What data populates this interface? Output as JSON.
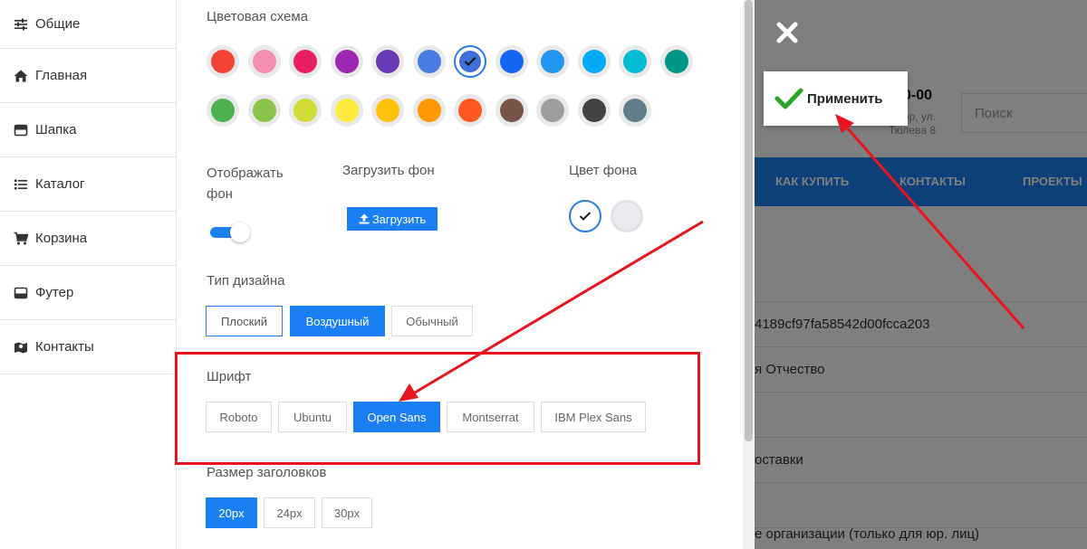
{
  "sidebar": {
    "items": [
      {
        "label": "Общие",
        "icon": "sliders-icon"
      },
      {
        "label": "Главная",
        "icon": "home-icon"
      },
      {
        "label": "Шапка",
        "icon": "header-icon"
      },
      {
        "label": "Каталог",
        "icon": "list-icon"
      },
      {
        "label": "Корзина",
        "icon": "cart-icon"
      },
      {
        "label": "Футер",
        "icon": "footer-icon"
      },
      {
        "label": "Контакты",
        "icon": "map-icon"
      }
    ]
  },
  "panel": {
    "color_scheme_label": "Цветовая схема",
    "colors_row1": [
      "#f44336",
      "#f48fb1",
      "#e91e63",
      "#9c27b0",
      "#673ab7",
      "#4a7be4",
      "#3f6fd8",
      "#1565f5",
      "#2196f3",
      "#03a9f4",
      "#00bcd4",
      "#009688"
    ],
    "colors_row2": [
      "#4caf50",
      "#8bc34a",
      "#cddc39",
      "#ffeb3b",
      "#ffc107",
      "#ff9800",
      "#ff5722",
      "#795548",
      "#9e9e9e",
      "#424242",
      "#607d8b"
    ],
    "selected_color": "#3f6fd8",
    "show_bg_label": "Отображать фон",
    "show_bg_enabled": true,
    "upload_bg_label": "Загрузить фон",
    "upload_button": "Загрузить",
    "bg_color_label": "Цвет фона",
    "design_type_label": "Тип дизайна",
    "design_types": [
      "Плоский",
      "Воздушный",
      "Обычный"
    ],
    "font_label": "Шрифт",
    "fonts": [
      "Roboto",
      "Ubuntu",
      "Open Sans",
      "Montserrat",
      "IBM Plex Sans"
    ],
    "heading_size_label": "Размер заголовков",
    "heading_sizes": [
      "20px",
      "24px",
      "30px"
    ],
    "accent": "#1a7ff2",
    "highlight": "#e8141e"
  },
  "site": {
    "phone": "0-00",
    "address_line1": "ор, ул.",
    "address_line2": "Тюлева 8",
    "search_placeholder": "Поиск",
    "nav": [
      "КАК КУПИТЬ",
      "КОНТАКТЫ",
      "ПРОЕКТЫ"
    ],
    "row_hash": "4189cf97fa58542d00fcca203",
    "row_name": "я Отчество",
    "row_delivery": "оставки",
    "row_org": "е организации (только для юр. лиц)"
  },
  "apply_button": "Применить"
}
